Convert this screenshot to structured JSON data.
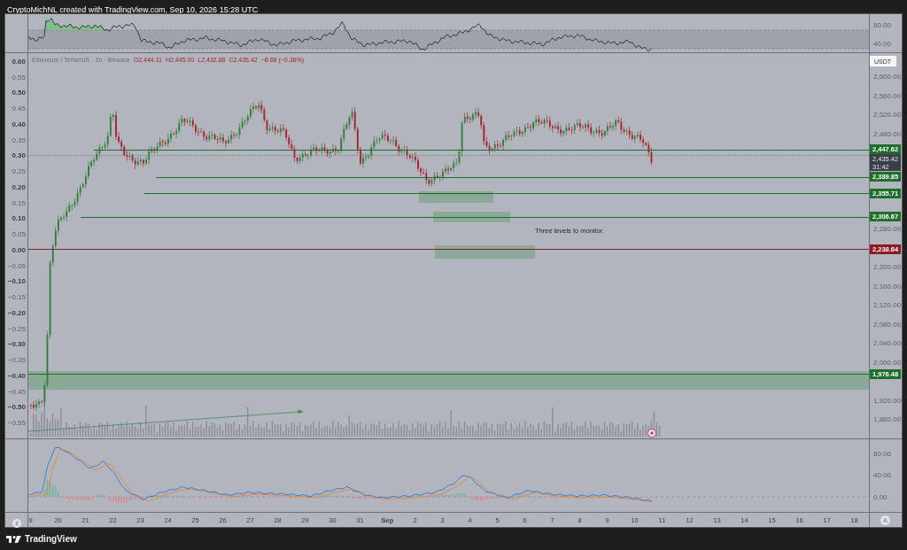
{
  "header": {
    "text": "CryptoMichNL created with TradingView.com, Sep 10, 2026 15:28 UTC"
  },
  "rsi_pane": {
    "axis_labels": [
      "80.00",
      "40.00"
    ]
  },
  "main_pane": {
    "symbol": "Ethereum / TetherUS · 1h · Binance",
    "ohlc": [
      {
        "label": "O",
        "value": "2,444.11"
      },
      {
        "label": "H",
        "value": "2,445.00"
      },
      {
        "label": "L",
        "value": "2,432.88"
      },
      {
        "label": "C",
        "value": "2,435.42"
      }
    ],
    "change": "−8.68 (−0.36%)",
    "currency": "USDT",
    "left_axis": [
      "0.60",
      "0.55",
      "0.50",
      "0.45",
      "0.40",
      "0.35",
      "0.30",
      "0.25",
      "0.20",
      "0.15",
      "0.10",
      "0.05",
      "0.00",
      "−0.05",
      "−0.10",
      "−0.15",
      "−0.20",
      "−0.25",
      "−0.30",
      "−0.35",
      "−0.40",
      "−0.45",
      "−0.50",
      "−0.55"
    ],
    "right_axis": [
      "2,600.00",
      "2,560.00",
      "2,520.00",
      "2,480.00",
      "2,280.00",
      "2,200.00",
      "2,160.00",
      "2,120.00",
      "2,080.00",
      "2,040.00",
      "2,000.00",
      "1,920.00",
      "1,880.00"
    ],
    "levels": [
      {
        "price": "2,447.62",
        "color": "#1e6e2c"
      },
      {
        "price": "2,389.85",
        "color": "#1e6e2c"
      },
      {
        "price": "2,355.71",
        "color": "#1e6e2c"
      },
      {
        "price": "2,306.67",
        "color": "#1e6e2c"
      },
      {
        "price": "2,238.64",
        "color": "#8e1b22"
      },
      {
        "price": "1,976.48",
        "color": "#1e6e2c"
      }
    ],
    "current_price": {
      "price": "2,435.42",
      "countdown": "31:42"
    },
    "annotation": "Three levels to monitor."
  },
  "macd_pane": {
    "axis_labels": [
      "80.00",
      "40.00",
      "0.00"
    ]
  },
  "time_axis": {
    "labels": [
      {
        "label": "9",
        "kind": "day"
      },
      {
        "label": "20",
        "kind": "day"
      },
      {
        "label": "21",
        "kind": "day"
      },
      {
        "label": "22",
        "kind": "day"
      },
      {
        "label": "23",
        "kind": "day"
      },
      {
        "label": "24",
        "kind": "day"
      },
      {
        "label": "25",
        "kind": "day"
      },
      {
        "label": "26",
        "kind": "day"
      },
      {
        "label": "27",
        "kind": "day"
      },
      {
        "label": "28",
        "kind": "day"
      },
      {
        "label": "29",
        "kind": "day"
      },
      {
        "label": "30",
        "kind": "day"
      },
      {
        "label": "31",
        "kind": "day"
      },
      {
        "label": "Sep",
        "kind": "month"
      },
      {
        "label": "2",
        "kind": "day"
      },
      {
        "label": "3",
        "kind": "day"
      },
      {
        "label": "4",
        "kind": "day"
      },
      {
        "label": "5",
        "kind": "day"
      },
      {
        "label": "6",
        "kind": "day"
      },
      {
        "label": "7",
        "kind": "day"
      },
      {
        "label": "8",
        "kind": "day"
      },
      {
        "label": "9",
        "kind": "day"
      },
      {
        "label": "10",
        "kind": "day"
      },
      {
        "label": "11",
        "kind": "day"
      },
      {
        "label": "12",
        "kind": "day"
      },
      {
        "label": "13",
        "kind": "day"
      },
      {
        "label": "14",
        "kind": "day"
      },
      {
        "label": "15",
        "kind": "day"
      },
      {
        "label": "16",
        "kind": "day"
      },
      {
        "label": "17",
        "kind": "day"
      },
      {
        "label": "18",
        "kind": "day"
      }
    ],
    "auto_button": "A"
  },
  "footer": {
    "brand": "TradingView"
  }
}
